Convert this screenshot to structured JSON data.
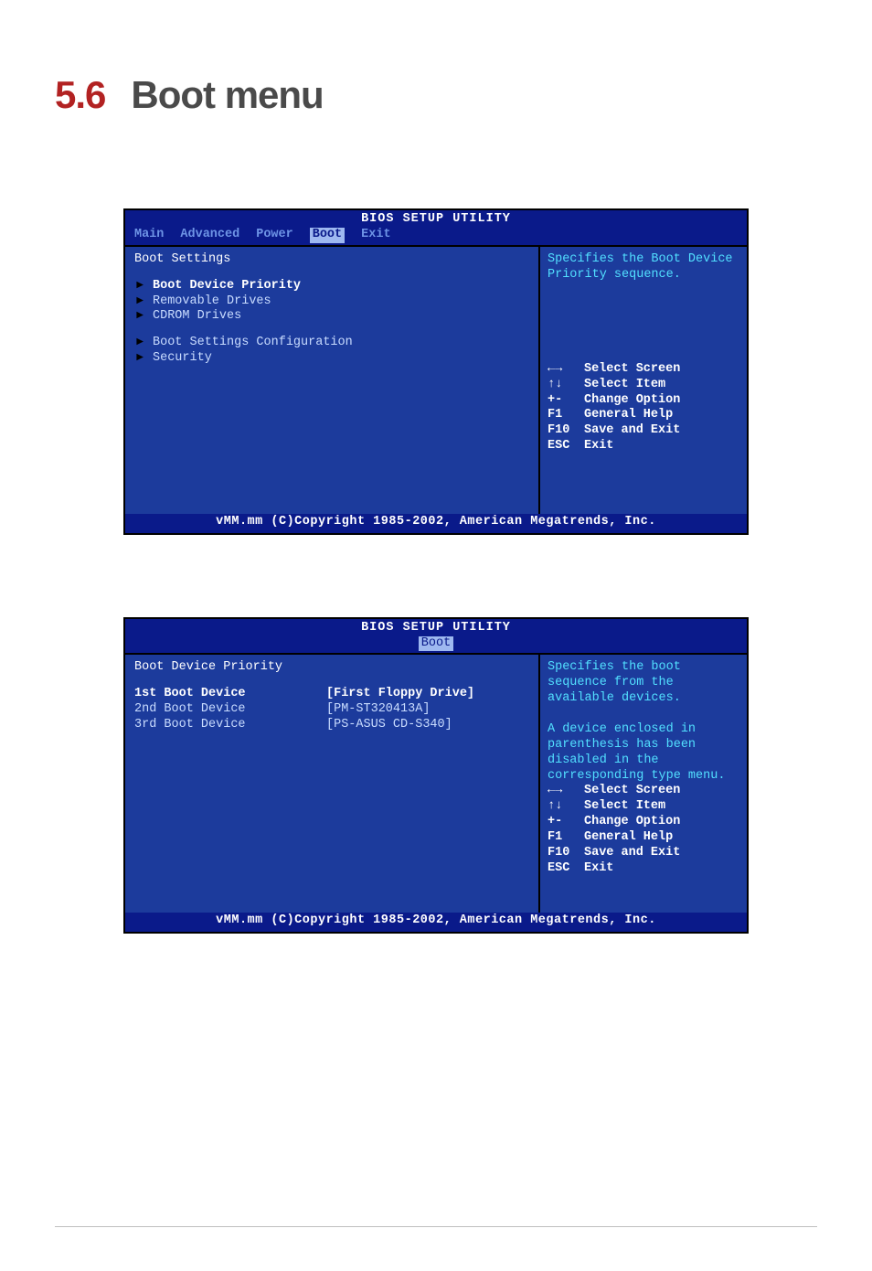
{
  "heading": {
    "num": "5.6",
    "title": "Boot menu"
  },
  "bios_title": "BIOS SETUP UTILITY",
  "menu": [
    "Main",
    "Advanced",
    "Power",
    "Boot",
    "Exit"
  ],
  "footer": "vMM.mm (C)Copyright 1985-2002, American Megatrends, Inc.",
  "key_help": [
    {
      "key": "←→",
      "label": "Select Screen"
    },
    {
      "key": "↑↓",
      "label": "Select Item"
    },
    {
      "key": "+-",
      "label": "Change Option"
    },
    {
      "key": "F1",
      "label": "General Help"
    },
    {
      "key": "F10",
      "label": "Save and Exit"
    },
    {
      "key": "ESC",
      "label": "Exit"
    }
  ],
  "shot1": {
    "heading": "Boot Settings",
    "items": [
      "Boot Device Priority",
      "Removable Drives",
      "CDROM Drives",
      "Boot Settings Configuration",
      "Security"
    ],
    "help": "Specifies the Boot Device Priority sequence."
  },
  "shot2": {
    "heading": "Boot Device Priority",
    "rows": [
      {
        "key": "1st Boot Device",
        "val": "[First Floppy Drive]"
      },
      {
        "key": "2nd Boot Device",
        "val": "[PM-ST320413A]"
      },
      {
        "key": "3rd Boot Device",
        "val": "[PS-ASUS CD-S340]"
      }
    ],
    "help": "Specifies the boot sequence from the available devices.\n\nA device enclosed in parenthesis has been disabled in the corresponding type menu."
  }
}
